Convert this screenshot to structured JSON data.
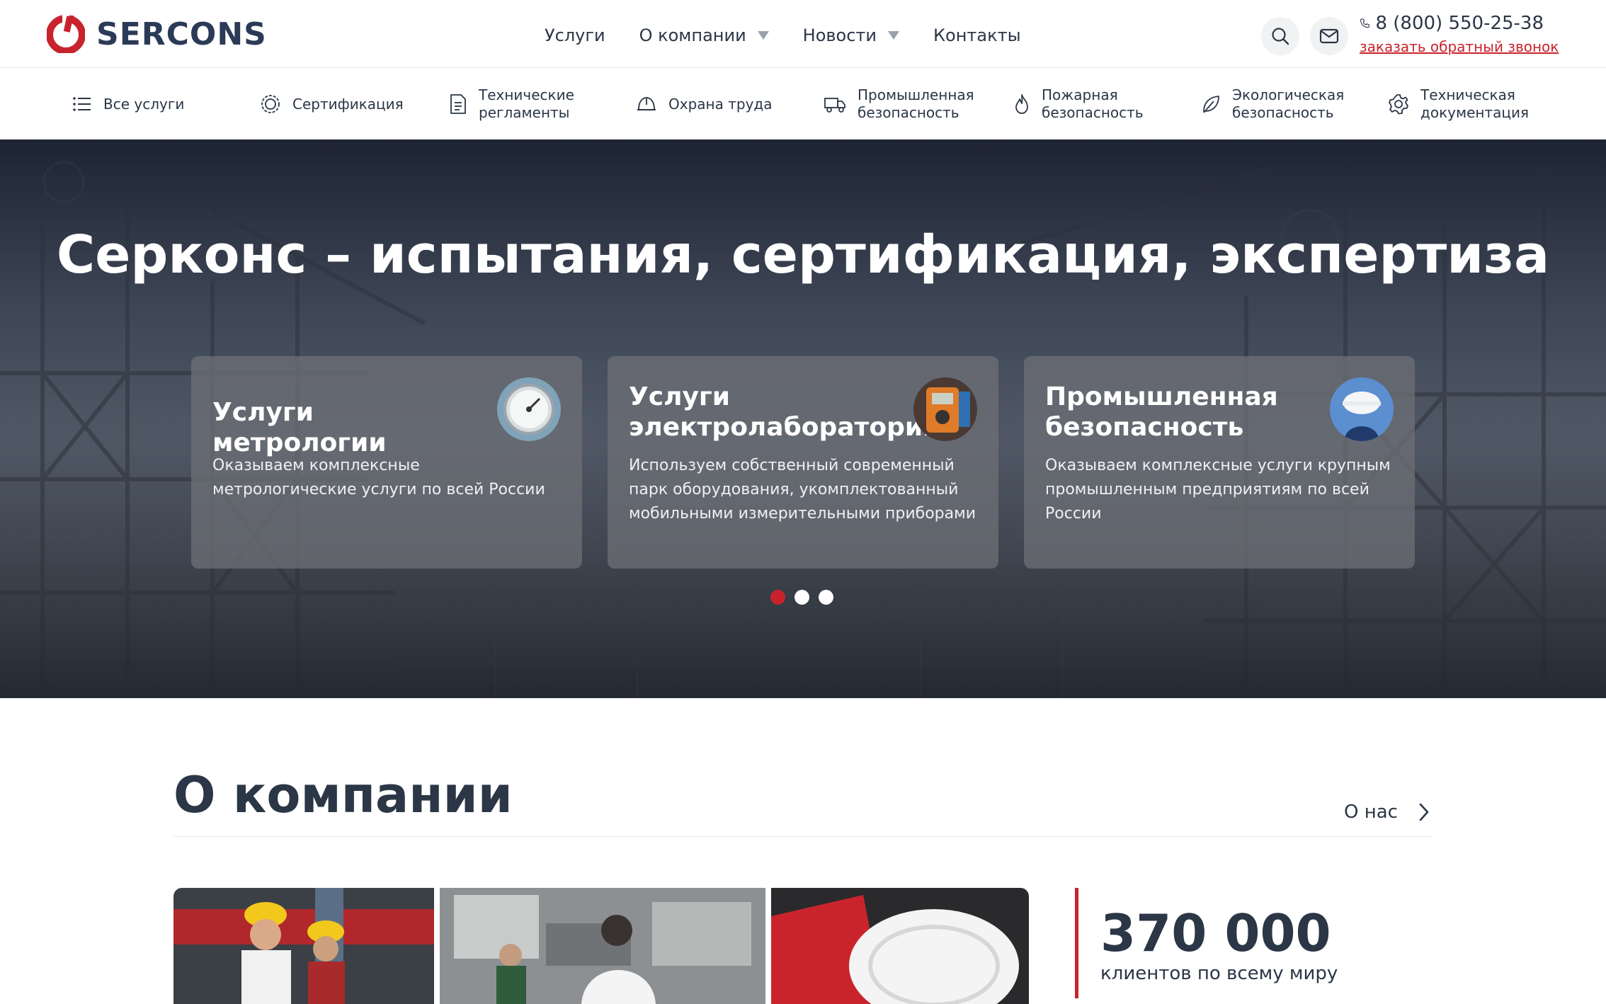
{
  "brand": {
    "name": "SERCONS",
    "accent": "#c8232c",
    "text": "#2b3646"
  },
  "header": {
    "nav": [
      {
        "label": "Услуги",
        "dropdown": false
      },
      {
        "label": "О компании",
        "dropdown": true
      },
      {
        "label": "Новости",
        "dropdown": true
      },
      {
        "label": "Контакты",
        "dropdown": false
      }
    ],
    "search_icon": "search-icon",
    "mail_icon": "mail-icon",
    "phone": "8 (800) 550-25-38",
    "callback": "заказать обратный звонок"
  },
  "services": [
    {
      "label": "Все услуги",
      "icon": "list-icon"
    },
    {
      "label": "Сертификация",
      "icon": "seal-icon"
    },
    {
      "label": "Технические регламенты",
      "icon": "document-icon"
    },
    {
      "label": "Охрана труда",
      "icon": "helmet-icon"
    },
    {
      "label": "Промышленная безопасность",
      "icon": "truck-icon"
    },
    {
      "label": "Пожарная безопасность",
      "icon": "flame-icon"
    },
    {
      "label": "Экологическая безопасность",
      "icon": "leaf-icon"
    },
    {
      "label": "Техническая документация",
      "icon": "gear-icon"
    }
  ],
  "hero": {
    "title": "Серконс – испытания, сертификация, экспертиза",
    "cards": [
      {
        "title": "Услуги метрологии",
        "text": "Оказываем комплексные метрологические услуги по всей России",
        "thumb": "pressure-gauge"
      },
      {
        "title": "Услуги электролаборатории",
        "text": "Используем собственный современный парк оборудования, укомплектованный мобильными измерительными приборами",
        "thumb": "multimeter"
      },
      {
        "title": "Промышленная безопасность",
        "text": "Оказываем комплексные услуги крупным промышленным предприятиям по всей России",
        "thumb": "worker-helmet"
      }
    ],
    "slides_total": 3,
    "active_slide": 1
  },
  "about": {
    "title": "О компании",
    "link": "О нас",
    "stat_value": "370 000",
    "stat_label": "клиентов по всему миру"
  }
}
